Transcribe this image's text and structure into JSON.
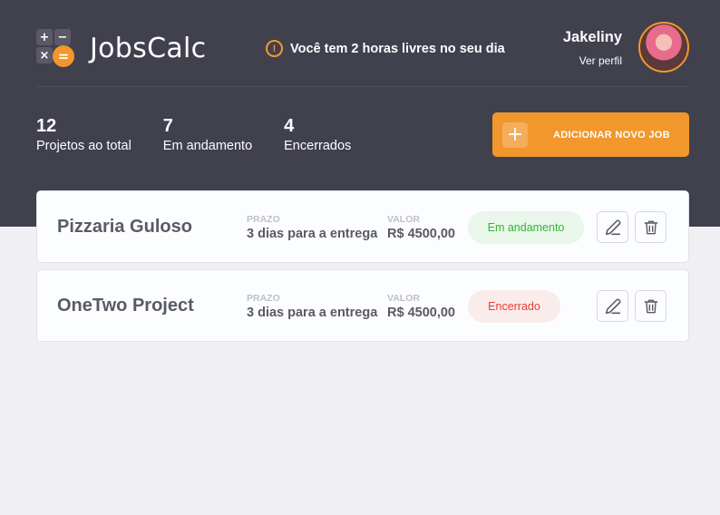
{
  "app": {
    "name": "JobsCalc",
    "logo_symbols": {
      "plus": "+",
      "minus": "−",
      "times": "×",
      "equals": "="
    }
  },
  "notice": {
    "icon": "exclamation-icon",
    "text": "Você tem 2 horas livres no seu dia"
  },
  "profile": {
    "name": "Jakeliny",
    "link_label": "Ver perfil"
  },
  "stats": [
    {
      "value": "12",
      "label": "Projetos ao total"
    },
    {
      "value": "7",
      "label": "Em andamento"
    },
    {
      "value": "4",
      "label": "Encerrados"
    }
  ],
  "add_button": {
    "icon": "+",
    "label": "ADICIONAR NOVO JOB"
  },
  "jobs": [
    {
      "name": "Pizzaria Guloso",
      "deadline_label": "PRAZO",
      "deadline": "3 dias para a entrega",
      "value_label": "VALOR",
      "value": "R$ 4500,00",
      "status": "Em andamento",
      "status_type": "progress"
    },
    {
      "name": "OneTwo Project",
      "deadline_label": "PRAZO",
      "deadline": "3 dias para a entrega",
      "value_label": "VALOR",
      "value": "R$ 4500,00",
      "status": "Encerrado",
      "status_type": "done"
    }
  ],
  "colors": {
    "header_bg": "#41414D",
    "accent": "#F1972C",
    "page_bg": "#F0F0F4",
    "status_progress_text": "#36B336",
    "status_progress_bg": "#E9F7EA",
    "status_done_text": "#EB3B35",
    "status_done_bg": "#FAECEB"
  }
}
